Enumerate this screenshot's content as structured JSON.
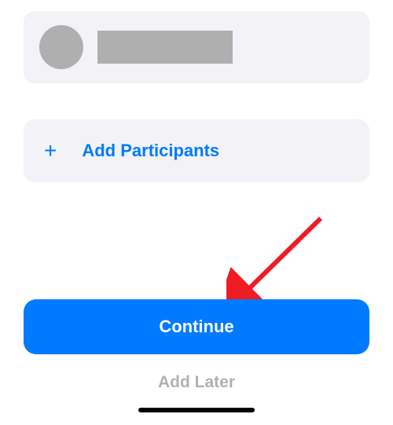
{
  "participant": {
    "name_redacted": true
  },
  "add_participants": {
    "icon_name": "plus-icon",
    "label": "Add Participants"
  },
  "actions": {
    "continue_label": "Continue",
    "add_later_label": "Add Later"
  },
  "colors": {
    "accent": "#007aff",
    "card_bg": "#f2f2f7",
    "redacted": "#afafaf",
    "muted_text": "#b0b0b5"
  }
}
